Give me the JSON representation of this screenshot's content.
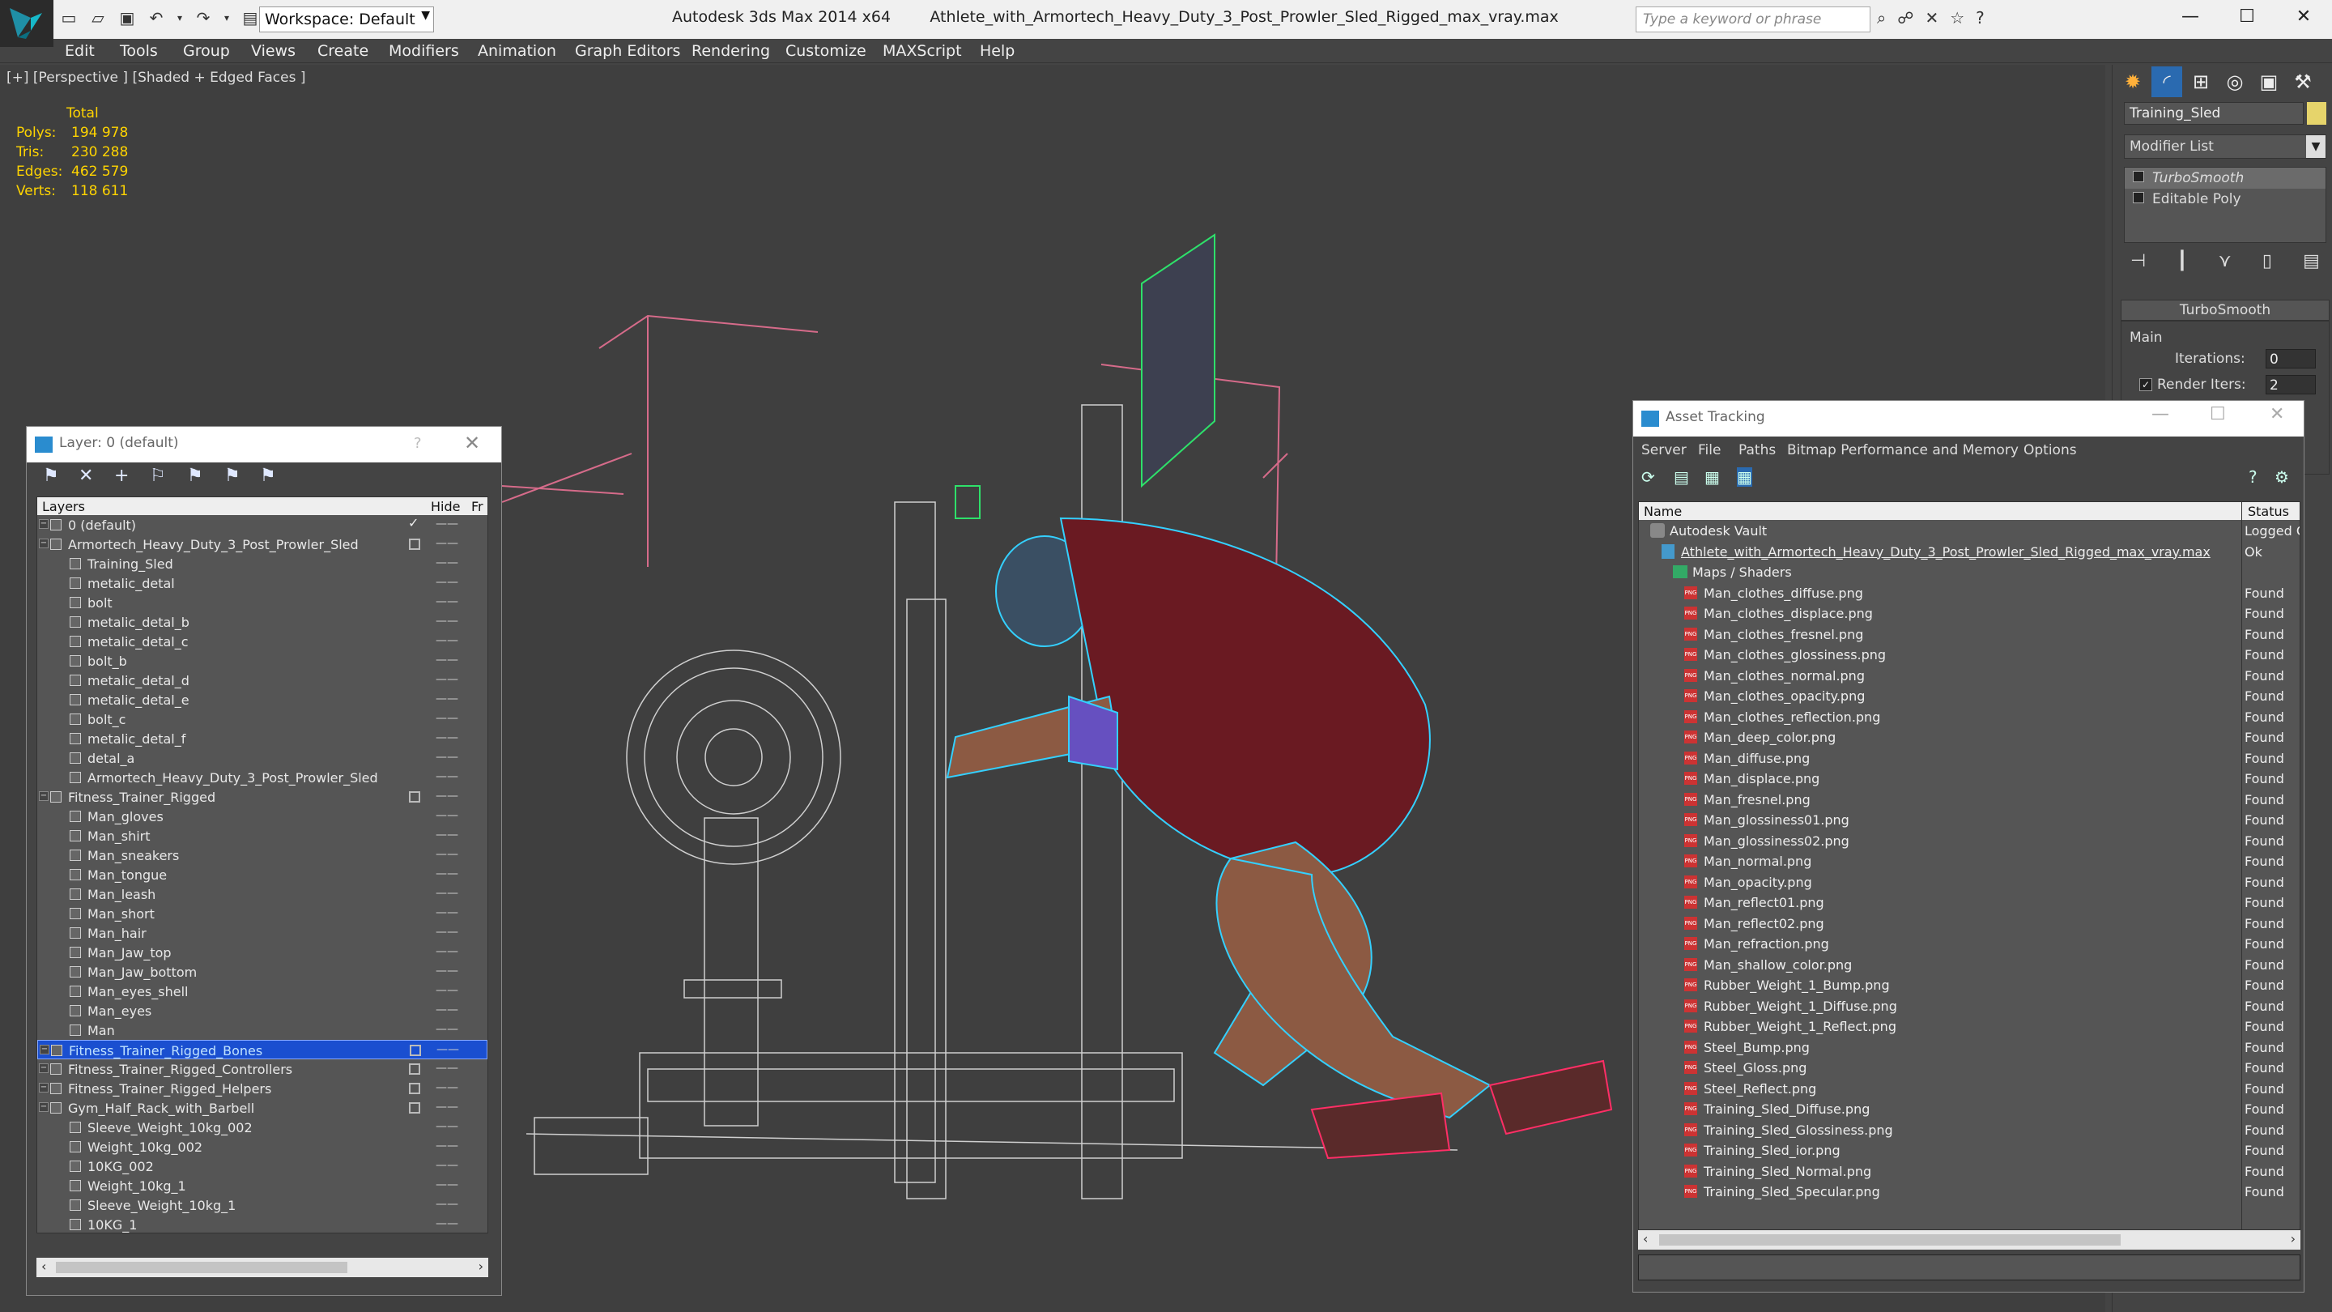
{
  "app": {
    "title": "Autodesk 3ds Max  2014 x64",
    "filename": "Athlete_with_Armortech_Heavy_Duty_3_Post_Prowler_Sled_Rigged_max_vray.max",
    "workspace": "Workspace: Default",
    "search_placeholder": "Type a keyword or phrase"
  },
  "menu": [
    "Edit",
    "Tools",
    "Group",
    "Views",
    "Create",
    "Modifiers",
    "Animation",
    "Graph Editors",
    "Rendering",
    "Customize",
    "MAXScript",
    "Help"
  ],
  "viewport": {
    "label": "[+] [Perspective ] [Shaded + Edged Faces ]",
    "stats": {
      "header": "Total",
      "rows": [
        {
          "k": "Polys:",
          "v": "194 978"
        },
        {
          "k": "Tris:",
          "v": "230 288"
        },
        {
          "k": "Edges:",
          "v": "462 579"
        },
        {
          "k": "Verts:",
          "v": "118 611"
        }
      ]
    }
  },
  "command_panel": {
    "object_name": "Training_Sled",
    "object_color": "#e6d46b",
    "modifier_list": "Modifier List",
    "stack": [
      "TurboSmooth",
      "Editable Poly"
    ],
    "rollout_title": "TurboSmooth",
    "group_main": "Main",
    "iterations_label": "Iterations:",
    "iterations_value": "0",
    "render_iters_label": "Render Iters:",
    "render_iters_value": "2"
  },
  "layer_window": {
    "title": "Layer: 0 (default)",
    "help": "?",
    "col_layers": "Layers",
    "col_hide": "Hide",
    "col_freeze": "Fr",
    "rows": [
      {
        "label": "0 (default)",
        "level": 0,
        "type": "layer",
        "current": true
      },
      {
        "label": "Armortech_Heavy_Duty_3_Post_Prowler_Sled",
        "level": 0,
        "type": "layer",
        "box": true
      },
      {
        "label": "Training_Sled",
        "level": 1,
        "type": "object"
      },
      {
        "label": "metalic_detal",
        "level": 1,
        "type": "object"
      },
      {
        "label": "bolt",
        "level": 1,
        "type": "object"
      },
      {
        "label": "metalic_detal_b",
        "level": 1,
        "type": "object"
      },
      {
        "label": "metalic_detal_c",
        "level": 1,
        "type": "object"
      },
      {
        "label": "bolt_b",
        "level": 1,
        "type": "object"
      },
      {
        "label": "metalic_detal_d",
        "level": 1,
        "type": "object"
      },
      {
        "label": "metalic_detal_e",
        "level": 1,
        "type": "object"
      },
      {
        "label": "bolt_c",
        "level": 1,
        "type": "object"
      },
      {
        "label": "metalic_detal_f",
        "level": 1,
        "type": "object"
      },
      {
        "label": "detal_a",
        "level": 1,
        "type": "object"
      },
      {
        "label": "Armortech_Heavy_Duty_3_Post_Prowler_Sled",
        "level": 1,
        "type": "object"
      },
      {
        "label": "Fitness_Trainer_Rigged",
        "level": 0,
        "type": "layer",
        "box": true
      },
      {
        "label": "Man_gloves",
        "level": 1,
        "type": "object"
      },
      {
        "label": "Man_shirt",
        "level": 1,
        "type": "object"
      },
      {
        "label": "Man_sneakers",
        "level": 1,
        "type": "object"
      },
      {
        "label": "Man_tongue",
        "level": 1,
        "type": "object"
      },
      {
        "label": "Man_leash",
        "level": 1,
        "type": "object"
      },
      {
        "label": "Man_short",
        "level": 1,
        "type": "object"
      },
      {
        "label": "Man_hair",
        "level": 1,
        "type": "object"
      },
      {
        "label": "Man_Jaw_top",
        "level": 1,
        "type": "object"
      },
      {
        "label": "Man_Jaw_bottom",
        "level": 1,
        "type": "object"
      },
      {
        "label": "Man_eyes_shell",
        "level": 1,
        "type": "object"
      },
      {
        "label": "Man_eyes",
        "level": 1,
        "type": "object"
      },
      {
        "label": "Man",
        "level": 1,
        "type": "object"
      },
      {
        "label": "Fitness_Trainer_Rigged_Bones",
        "level": 0,
        "type": "layer",
        "box": true,
        "selected": true
      },
      {
        "label": "Fitness_Trainer_Rigged_Controllers",
        "level": 0,
        "type": "layer",
        "box": true
      },
      {
        "label": "Fitness_Trainer_Rigged_Helpers",
        "level": 0,
        "type": "layer",
        "box": true
      },
      {
        "label": "Gym_Half_Rack_with_Barbell",
        "level": 0,
        "type": "layer",
        "box": true
      },
      {
        "label": "Sleeve_Weight_10kg_002",
        "level": 1,
        "type": "object"
      },
      {
        "label": "Weight_10kg_002",
        "level": 1,
        "type": "object"
      },
      {
        "label": "10KG_002",
        "level": 1,
        "type": "object"
      },
      {
        "label": "Weight_10kg_1",
        "level": 1,
        "type": "object"
      },
      {
        "label": "Sleeve_Weight_10kg_1",
        "level": 1,
        "type": "object"
      },
      {
        "label": "10KG_1",
        "level": 1,
        "type": "object"
      }
    ]
  },
  "asset_window": {
    "title": "Asset Tracking",
    "menu": [
      "Server",
      "File",
      "Paths",
      "Bitmap Performance and Memory",
      "Options"
    ],
    "col_name": "Name",
    "col_status": "Status",
    "rows": [
      {
        "label": "Autodesk Vault",
        "level": 0,
        "kind": "vault",
        "status": "Logged C"
      },
      {
        "label": "Athlete_with_Armortech_Heavy_Duty_3_Post_Prowler_Sled_Rigged_max_vray.max",
        "level": 1,
        "kind": "file",
        "status": "Ok"
      },
      {
        "label": "Maps / Shaders",
        "level": 2,
        "kind": "folder",
        "status": ""
      },
      {
        "label": "Man_clothes_diffuse.png",
        "level": 3,
        "kind": "png",
        "status": "Found"
      },
      {
        "label": "Man_clothes_displace.png",
        "level": 3,
        "kind": "png",
        "status": "Found"
      },
      {
        "label": "Man_clothes_fresnel.png",
        "level": 3,
        "kind": "png",
        "status": "Found"
      },
      {
        "label": "Man_clothes_glossiness.png",
        "level": 3,
        "kind": "png",
        "status": "Found"
      },
      {
        "label": "Man_clothes_normal.png",
        "level": 3,
        "kind": "png",
        "status": "Found"
      },
      {
        "label": "Man_clothes_opacity.png",
        "level": 3,
        "kind": "png",
        "status": "Found"
      },
      {
        "label": "Man_clothes_reflection.png",
        "level": 3,
        "kind": "png",
        "status": "Found"
      },
      {
        "label": "Man_deep_color.png",
        "level": 3,
        "kind": "png",
        "status": "Found"
      },
      {
        "label": "Man_diffuse.png",
        "level": 3,
        "kind": "png",
        "status": "Found"
      },
      {
        "label": "Man_displace.png",
        "level": 3,
        "kind": "png",
        "status": "Found"
      },
      {
        "label": "Man_fresnel.png",
        "level": 3,
        "kind": "png",
        "status": "Found"
      },
      {
        "label": "Man_glossiness01.png",
        "level": 3,
        "kind": "png",
        "status": "Found"
      },
      {
        "label": "Man_glossiness02.png",
        "level": 3,
        "kind": "png",
        "status": "Found"
      },
      {
        "label": "Man_normal.png",
        "level": 3,
        "kind": "png",
        "status": "Found"
      },
      {
        "label": "Man_opacity.png",
        "level": 3,
        "kind": "png",
        "status": "Found"
      },
      {
        "label": "Man_reflect01.png",
        "level": 3,
        "kind": "png",
        "status": "Found"
      },
      {
        "label": "Man_reflect02.png",
        "level": 3,
        "kind": "png",
        "status": "Found"
      },
      {
        "label": "Man_refraction.png",
        "level": 3,
        "kind": "png",
        "status": "Found"
      },
      {
        "label": "Man_shallow_color.png",
        "level": 3,
        "kind": "png",
        "status": "Found"
      },
      {
        "label": "Rubber_Weight_1_Bump.png",
        "level": 3,
        "kind": "png",
        "status": "Found"
      },
      {
        "label": "Rubber_Weight_1_Diffuse.png",
        "level": 3,
        "kind": "png",
        "status": "Found"
      },
      {
        "label": "Rubber_Weight_1_Reflect.png",
        "level": 3,
        "kind": "png",
        "status": "Found"
      },
      {
        "label": "Steel_Bump.png",
        "level": 3,
        "kind": "png",
        "status": "Found"
      },
      {
        "label": "Steel_Gloss.png",
        "level": 3,
        "kind": "png",
        "status": "Found"
      },
      {
        "label": "Steel_Reflect.png",
        "level": 3,
        "kind": "png",
        "status": "Found"
      },
      {
        "label": "Training_Sled_Diffuse.png",
        "level": 3,
        "kind": "png",
        "status": "Found"
      },
      {
        "label": "Training_Sled_Glossiness.png",
        "level": 3,
        "kind": "png",
        "status": "Found"
      },
      {
        "label": "Training_Sled_ior.png",
        "level": 3,
        "kind": "png",
        "status": "Found"
      },
      {
        "label": "Training_Sled_Normal.png",
        "level": 3,
        "kind": "png",
        "status": "Found"
      },
      {
        "label": "Training_Sled_Specular.png",
        "level": 3,
        "kind": "png",
        "status": "Found"
      }
    ]
  }
}
